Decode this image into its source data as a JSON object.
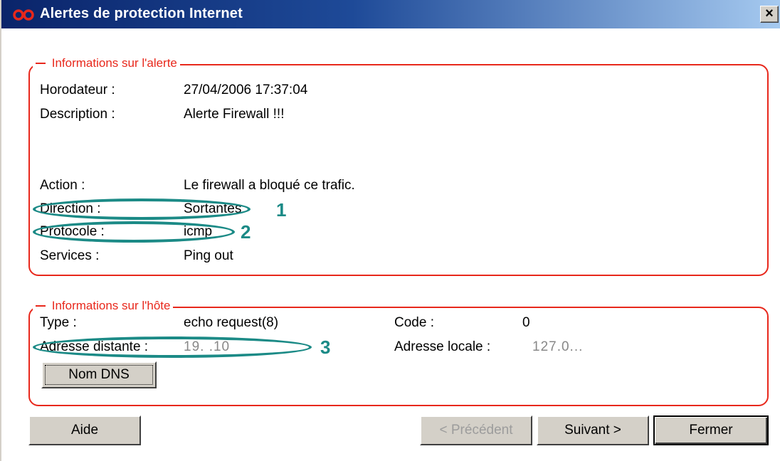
{
  "window": {
    "title": "Alertes de protection Internet",
    "close_glyph": "×",
    "accent_title": "#0a246a",
    "accent_frame": "#e8281c",
    "accent_marker": "#1b8a86"
  },
  "alert_info": {
    "legend": "Informations sur l'alerte",
    "rows": [
      {
        "label": "Horodateur :",
        "value": "27/04/2006 17:37:04"
      },
      {
        "label": "Description :",
        "value": "Alerte Firewall !!!"
      },
      {
        "label": "Action :",
        "value": "Le firewall a bloqué ce trafic."
      },
      {
        "label": "Direction :",
        "value": "Sortantes"
      },
      {
        "label": "Protocole :",
        "value": "icmp"
      },
      {
        "label": "Services :",
        "value": "Ping out"
      }
    ]
  },
  "host_info": {
    "legend": "Informations sur l'hôte",
    "type_label": "Type :",
    "type_value": "echo request(8)",
    "code_label": "Code :",
    "code_value": "0",
    "remote_label": "Adresse distante :",
    "remote_value": "19.     .10",
    "local_label": "Adresse locale :",
    "local_value": "127.0...",
    "dns_button": "Nom DNS"
  },
  "annotations": {
    "mark1": "1",
    "mark2": "2",
    "mark3": "3"
  },
  "buttons": {
    "help": "Aide",
    "previous": "< Précédent",
    "next": "Suivant >",
    "close": "Fermer"
  },
  "icons": {
    "app": "infinity-logo-icon",
    "close": "close-icon"
  }
}
